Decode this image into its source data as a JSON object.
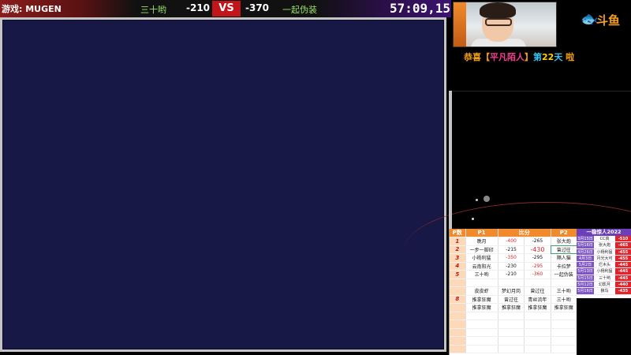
{
  "topbar": {
    "game_label": "游戏: MUGEN",
    "p1_name": "三十哟",
    "p1_score": "-210",
    "vs_label": "VS",
    "p2_score": "-370",
    "p2_name": "一起伪装",
    "timer": "57:09,15"
  },
  "logo": {
    "text": "斗鱼",
    "icon": "douyu-fish-icon"
  },
  "congrats": {
    "prefix": "恭喜【",
    "name": "平凡陌人",
    "mid": "】",
    "day_prefix": "第",
    "day_num": "22",
    "day_suffix": "天",
    "suffix": " 啦"
  },
  "score_table": {
    "headers": [
      "P数",
      "P1",
      "比分",
      "",
      "P2"
    ],
    "rows": [
      {
        "round": "1",
        "p1": "晚月",
        "s1": "-400",
        "s2": "-265",
        "p2": "张大炮"
      },
      {
        "round": "2",
        "p1": "一步一脚印",
        "s1": "-215",
        "s2": "-430",
        "p2": "曾过往"
      },
      {
        "round": "3",
        "p1": "小杨利猛",
        "s1": "-350",
        "s2": "-295",
        "p2": "隔人猫"
      },
      {
        "round": "4",
        "p1": "云南阳光",
        "s1": "-230",
        "s2": "-295",
        "p2": "卡拉梦"
      },
      {
        "round": "5",
        "p1": "三十哟",
        "s1": "-210",
        "s2": "-360",
        "p2": "一起伪装"
      },
      {
        "round": "",
        "p1": "",
        "s1": "",
        "s2": "",
        "p2": ""
      },
      {
        "round": "",
        "p1": "皮皮虾",
        "s1": "梦幻月岗",
        "s2": "曾过往",
        "p2": "三十哟"
      },
      {
        "round": "8",
        "p1": "推拿狂魔",
        "s1": "曾过往",
        "s2": "青丝流年",
        "p2": "三十哟"
      },
      {
        "round": "",
        "p1": "推拿狂魔",
        "s1": "推拿狂魔",
        "s2": "推拿狂魔",
        "p2": "推拿狂魔"
      },
      {
        "round": "",
        "p1": "",
        "s1": "",
        "s2": "",
        "p2": ""
      },
      {
        "round": "",
        "p1": "",
        "s1": "",
        "s2": "",
        "p2": ""
      },
      {
        "round": "",
        "p1": "",
        "s1": "",
        "s2": "",
        "p2": ""
      },
      {
        "round": "",
        "p1": "",
        "s1": "",
        "s2": "",
        "p2": ""
      },
      {
        "round": "",
        "p1": "",
        "s1": "",
        "s2": "",
        "p2": ""
      }
    ]
  },
  "leaderboard": {
    "title": "一稳惊人2022",
    "rows": [
      {
        "date": "3月15日",
        "name": "CC真",
        "score": "-510"
      },
      {
        "date": "5月16日",
        "name": "张大炮",
        "score": "-465"
      },
      {
        "date": "4月26日",
        "name": "小杨利猛",
        "score": "-455"
      },
      {
        "date": "4月3日",
        "name": "月光大可",
        "score": "-455"
      },
      {
        "date": "5月2日",
        "name": "烂木头",
        "score": "-445"
      },
      {
        "date": "5月13日",
        "name": "小杨利猛",
        "score": "-445"
      },
      {
        "date": "5月15日",
        "name": "三十哟",
        "score": "-445"
      },
      {
        "date": "5月12日",
        "name": "幻影月",
        "score": "-440"
      },
      {
        "date": "5月16日",
        "name": "狼鸟",
        "score": "-435"
      }
    ]
  },
  "colors": {
    "accent_orange": "#f08a2c",
    "vs_red": "#c0161a",
    "game_bg": "#181846",
    "leaderboard_purple": "#6b3fb8"
  }
}
